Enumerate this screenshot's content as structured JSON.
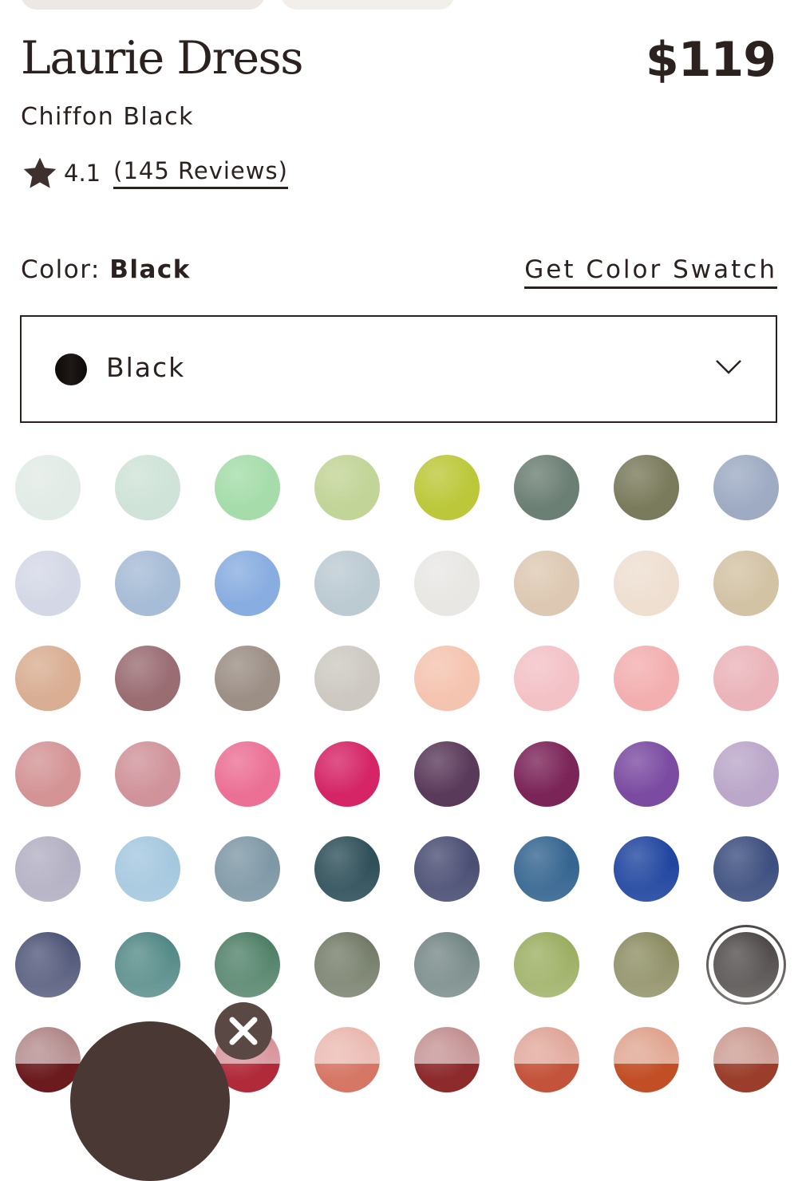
{
  "product": {
    "name": "Laurie Dress",
    "price": "$119",
    "variant": "Chiffon Black",
    "rating": "4.1",
    "reviews_label": "(145 Reviews)"
  },
  "color": {
    "label": "Color:",
    "selected": "Black",
    "swatch_link": "Get Color Swatch"
  },
  "icons": {
    "rating": "star-icon",
    "dropdown": "chevron-down-icon",
    "close": "close-icon"
  },
  "swatch_colors": [
    "#e2ebe6",
    "#cfe3d8",
    "#a5dcaa",
    "#c2d497",
    "#bcc83a",
    "#6c7f74",
    "#7a7a5c",
    "#9eabc3",
    "#d4d8e6",
    "#a7bcd6",
    "#88ade0",
    "#bccad2",
    "#e9e7e4",
    "#ddc9b3",
    "#eedfd1",
    "#d3c3a5",
    "#d9ae93",
    "#9a6d73",
    "#9c8f86",
    "#cdc9c2",
    "#f5c4b0",
    "#f3c2c7",
    "#f3afb0",
    "#eab4ba",
    "#d49496",
    "#d0939b",
    "#ec7096",
    "#d52567",
    "#5a3a5a",
    "#7b2458",
    "#7b4ba2",
    "#bba7c9",
    "#b3b0c3",
    "#a5c8df",
    "#7f98a6",
    "#2f505a",
    "#4b4f74",
    "#356590",
    "#2146a0",
    "#3d4f7f",
    "#1c2450",
    "#1f6662",
    "#1b5a3a",
    "#4a553b",
    "#4c6462",
    "#7d9632",
    "#6a6b34",
    "#1c1614",
    "#6b1b1e",
    "#8a2c3a",
    "#b02a3a",
    "#d67766",
    "#8c2a2c",
    "#c4533b",
    "#c24e25",
    "#9a3d2a"
  ],
  "selected_swatch": 47
}
